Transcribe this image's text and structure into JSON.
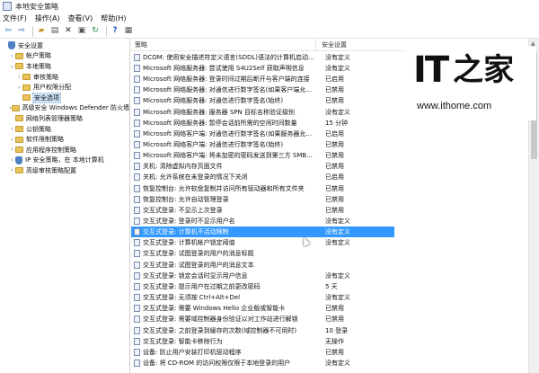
{
  "window": {
    "title": "本地安全策略"
  },
  "menu": [
    "文件(F)",
    "操作(A)",
    "查看(V)",
    "帮助(H)"
  ],
  "toolbar": [
    "back-arrow-icon",
    "forward-arrow-icon",
    "folder-up-icon",
    "properties-icon",
    "delete-icon",
    "export-icon",
    "refresh-icon",
    "help-icon",
    "view-icon"
  ],
  "tree": [
    {
      "label": "安全设置",
      "level": 0,
      "expander": "",
      "icon": "shield"
    },
    {
      "label": "帐户策略",
      "level": 1,
      "expander": "›",
      "icon": "folder"
    },
    {
      "label": "本地策略",
      "level": 1,
      "expander": "⌄",
      "icon": "folder"
    },
    {
      "label": "审核策略",
      "level": 2,
      "expander": "›",
      "icon": "folder"
    },
    {
      "label": "用户权限分配",
      "level": 2,
      "expander": "›",
      "icon": "folder"
    },
    {
      "label": "安全选项",
      "level": 2,
      "expander": "",
      "icon": "folder",
      "selected": true
    },
    {
      "label": "高级安全 Windows Defender 防火墙",
      "level": 1,
      "expander": "›",
      "icon": "folder"
    },
    {
      "label": "网络列表管理器策略",
      "level": 1,
      "expander": "",
      "icon": "folder"
    },
    {
      "label": "公钥策略",
      "level": 1,
      "expander": "›",
      "icon": "folder"
    },
    {
      "label": "软件限制策略",
      "level": 1,
      "expander": "›",
      "icon": "folder"
    },
    {
      "label": "应用程序控制策略",
      "level": 1,
      "expander": "›",
      "icon": "folder"
    },
    {
      "label": "IP 安全策略，在 本地计算机",
      "level": 1,
      "expander": "›",
      "icon": "shield"
    },
    {
      "label": "高级审核策略配置",
      "level": 1,
      "expander": "›",
      "icon": "folder"
    }
  ],
  "list": {
    "col_policy": "策略",
    "col_setting": "安全设置",
    "rows": [
      {
        "name": "DCOM: 使用安全描述符定义语言(SDDL)语法的计算机启动...",
        "setting": "没有定义"
      },
      {
        "name": "Microsoft 网络服务器: 尝试使用 S4U2Self 获取声明信息",
        "setting": "没有定义"
      },
      {
        "name": "Microsoft 网络服务器: 登录时间过期后断开与客户端的连接",
        "setting": "已启用"
      },
      {
        "name": "Microsoft 网络服务器: 对通信进行数字签名(如果客户端允...",
        "setting": "已禁用"
      },
      {
        "name": "Microsoft 网络服务器: 对通信进行数字签名(始终)",
        "setting": "已禁用"
      },
      {
        "name": "Microsoft 网络服务器: 服务器 SPN 目标名称验证级别",
        "setting": "没有定义"
      },
      {
        "name": "Microsoft 网络服务器: 暂停会话前所需的空闲时间数量",
        "setting": "15 分钟"
      },
      {
        "name": "Microsoft 网络客户端: 对通信进行数字签名(如果服务器允...",
        "setting": "已启用"
      },
      {
        "name": "Microsoft 网络客户端: 对通信进行数字签名(始终)",
        "setting": "已禁用"
      },
      {
        "name": "Microsoft 网络客户端: 将未加密的密码发送到第三方 SMB...",
        "setting": "已禁用"
      },
      {
        "name": "关机: 清除虚拟内存页面文件",
        "setting": "已禁用"
      },
      {
        "name": "关机: 允许系统在未登录的情况下关闭",
        "setting": "已启用"
      },
      {
        "name": "恢复控制台: 允许软盘复制并访问所有驱动器和所有文件夹",
        "setting": "已禁用"
      },
      {
        "name": "恢复控制台: 允许自动管理登录",
        "setting": "已禁用"
      },
      {
        "name": "交互式登录: 不显示上次登录",
        "setting": "已禁用"
      },
      {
        "name": "交互式登录: 登录时不显示用户名",
        "setting": "没有定义"
      },
      {
        "name": "交互式登录: 计算机不活动限制",
        "setting": "没有定义",
        "selected": true
      },
      {
        "name": "交互式登录: 计算机帐户锁定阈值",
        "setting": "没有定义"
      },
      {
        "name": "交互式登录: 试图登录的用户的消息标题",
        "setting": ""
      },
      {
        "name": "交互式登录: 试图登录的用户的消息文本",
        "setting": ""
      },
      {
        "name": "交互式登录: 锁定会话时显示用户信息",
        "setting": "没有定义"
      },
      {
        "name": "交互式登录: 提示用户在过期之前更改密码",
        "setting": "5 天"
      },
      {
        "name": "交互式登录: 无须按 Ctrl+Alt+Del",
        "setting": "没有定义"
      },
      {
        "name": "交互式登录: 需要 Windows Hello 企业版或智能卡",
        "setting": "已禁用"
      },
      {
        "name": "交互式登录: 需要域控制器身份验证以对工作站进行解锁",
        "setting": "已禁用"
      },
      {
        "name": "交互式登录: 之前登录到缓存的次数(域控制器不可用时)",
        "setting": "10 登录"
      },
      {
        "name": "交互式登录: 智能卡移除行为",
        "setting": "无操作"
      },
      {
        "name": "设备: 防止用户安装打印机驱动程序",
        "setting": "已禁用"
      },
      {
        "name": "设备: 将 CD-ROM 的访问权限仅限于本地登录的用户",
        "setting": "没有定义"
      }
    ]
  },
  "watermark": {
    "url": "www.ithome.com"
  }
}
